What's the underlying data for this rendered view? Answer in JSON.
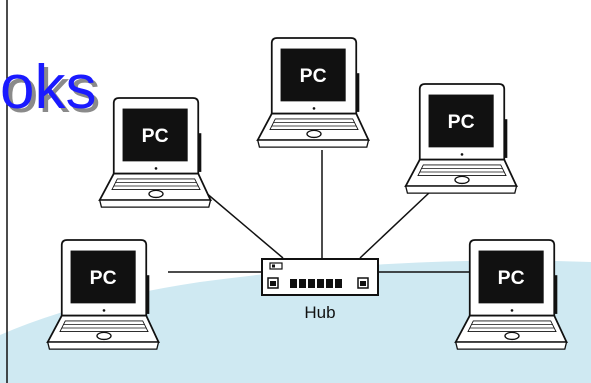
{
  "title_fragment": "oks",
  "laptops": [
    {
      "id": "top-center",
      "label": "PC"
    },
    {
      "id": "upper-left",
      "label": "PC"
    },
    {
      "id": "upper-right",
      "label": "PC"
    },
    {
      "id": "lower-left",
      "label": "PC"
    },
    {
      "id": "lower-right",
      "label": "PC"
    }
  ],
  "hub": {
    "label": "Hub"
  },
  "colors": {
    "title_blue": "#1a1aff",
    "title_shadow": "#8a8a8a",
    "floor": "#cfe9f2",
    "line": "#111111",
    "screen": "#111111"
  }
}
